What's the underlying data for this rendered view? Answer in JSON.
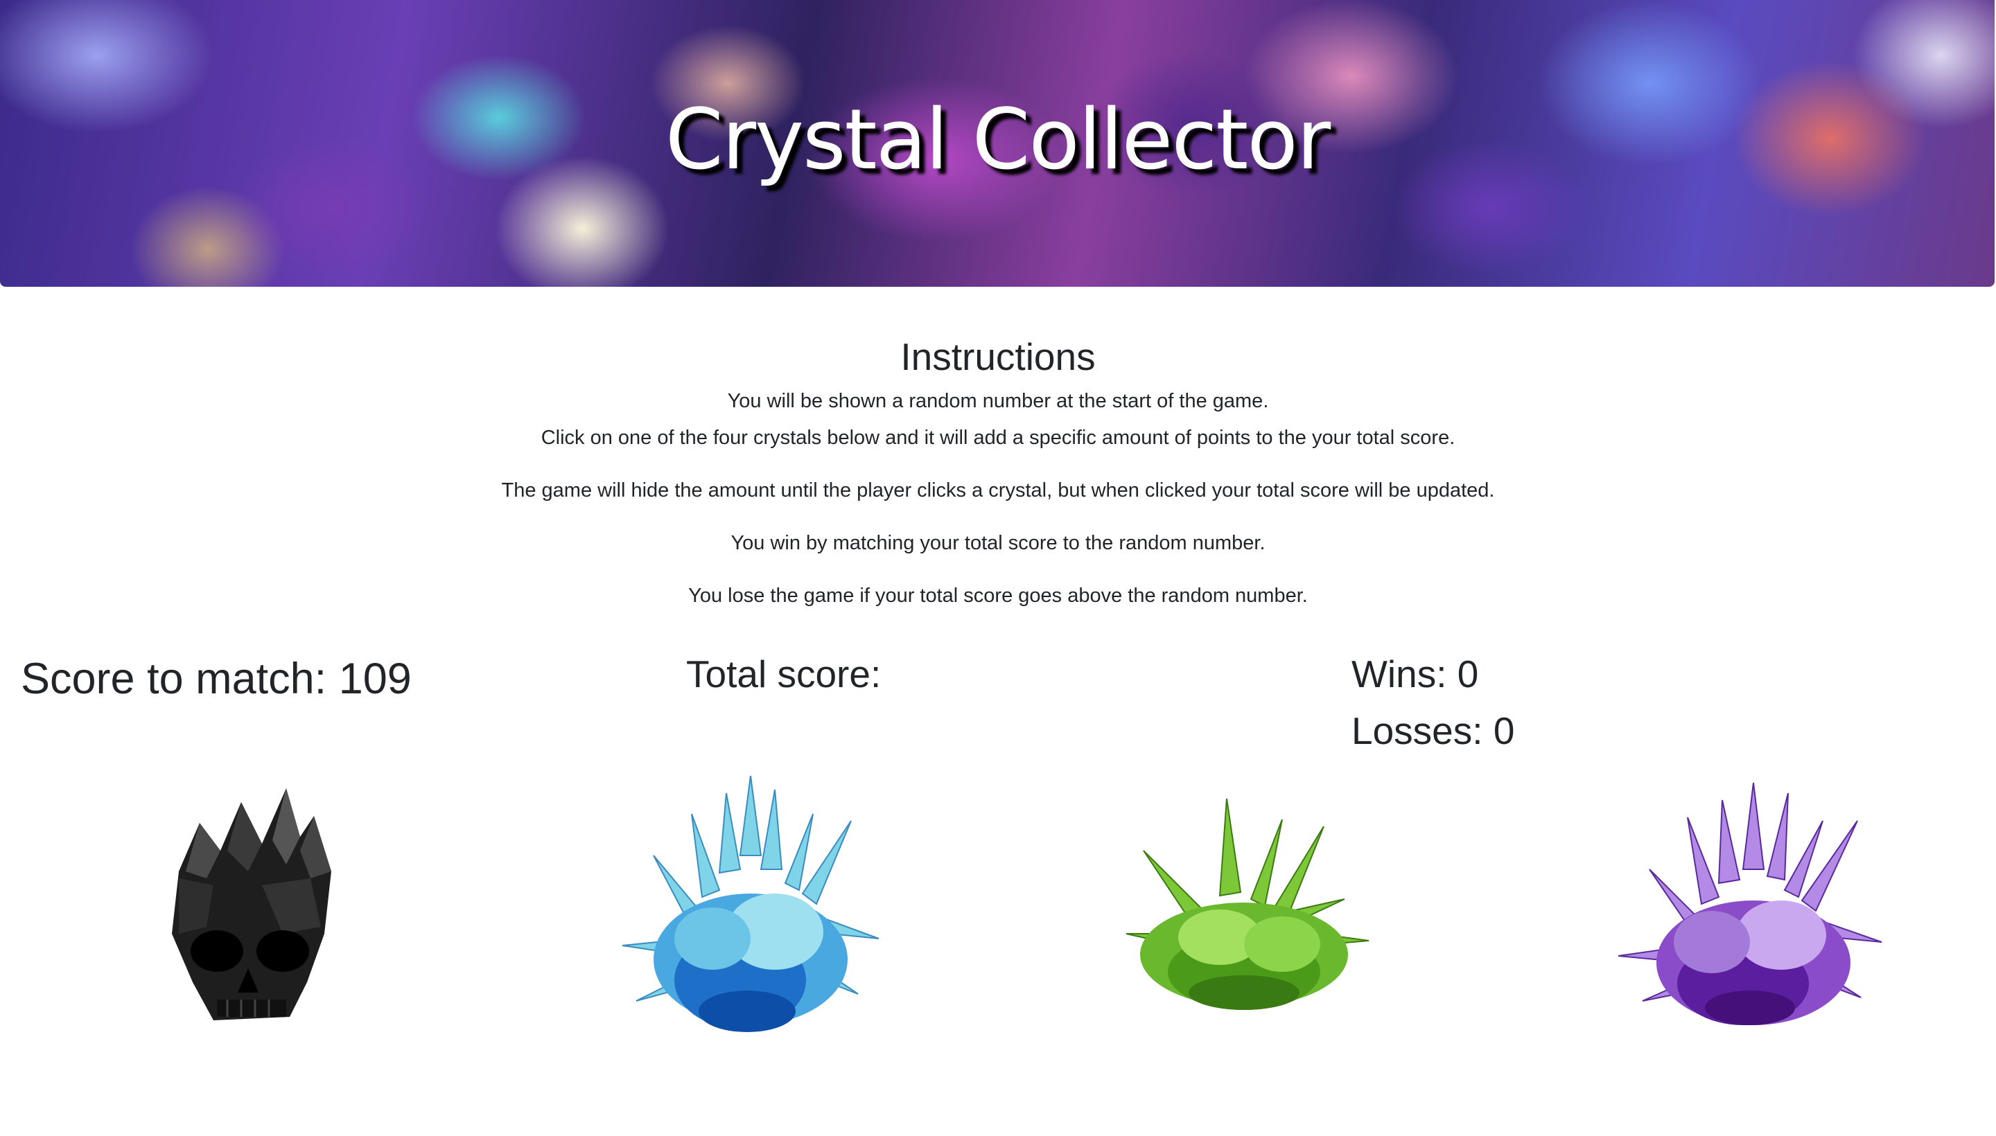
{
  "header": {
    "title": "Crystal Collector"
  },
  "instructions": {
    "heading": "Instructions",
    "lines": [
      "You will be shown a random number at the start of the game.",
      "Click on one of the four crystals below and it will add a specific amount of points to the your total score.",
      "The game will hide the amount until the player clicks a crystal, but when clicked your total score will be updated.",
      "You win by matching your total score to the random number.",
      "You lose the game if your total score goes above the random number."
    ]
  },
  "stats": {
    "score_to_match": "Score to match: 109",
    "total_score": "Total score:",
    "wins": "Wins: 0",
    "losses": "Losses: 0"
  },
  "crystals": [
    {
      "name": "black-skull-crystal",
      "color": "#2a2a2a"
    },
    {
      "name": "blue-crystal",
      "color": "#4aa8e0"
    },
    {
      "name": "green-crystal",
      "color": "#6ab82e"
    },
    {
      "name": "purple-crystal",
      "color": "#8a4cc8"
    }
  ]
}
